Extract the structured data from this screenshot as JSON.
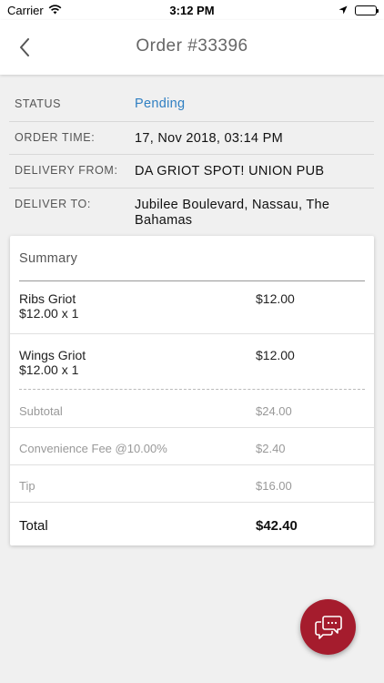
{
  "status_bar": {
    "carrier": "Carrier",
    "time": "3:12 PM"
  },
  "nav": {
    "title": "Order #33396"
  },
  "info": {
    "status_label": "STATUS",
    "status_value": "Pending",
    "order_time_label": "ORDER TIME:",
    "order_time_value": "17, Nov 2018, 03:14 PM",
    "delivery_from_label": "DELIVERY FROM:",
    "delivery_from_value": "DA GRIOT SPOT! UNION PUB",
    "deliver_to_label": "DELIVER TO:",
    "deliver_to_value": "Jubilee Boulevard, Nassau, The Bahamas"
  },
  "summary": {
    "title": "Summary",
    "items": [
      {
        "name": "Ribs Griot",
        "qty": "$12.00 x 1",
        "price": "$12.00"
      },
      {
        "name": "Wings Griot",
        "qty": "$12.00 x 1",
        "price": "$12.00"
      }
    ],
    "subtotal_label": "Subtotal",
    "subtotal_value": "$24.00",
    "fee_label": "Convenience Fee @10.00%",
    "fee_value": "$2.40",
    "tip_label": "Tip",
    "tip_value": "$16.00",
    "total_label": "Total",
    "total_value": "$42.40"
  },
  "colors": {
    "accent_link": "#2f7fc2",
    "fab": "#a51c2d"
  },
  "icons": {
    "back": "chevron-left-icon",
    "chat": "chat-bubbles-icon"
  }
}
